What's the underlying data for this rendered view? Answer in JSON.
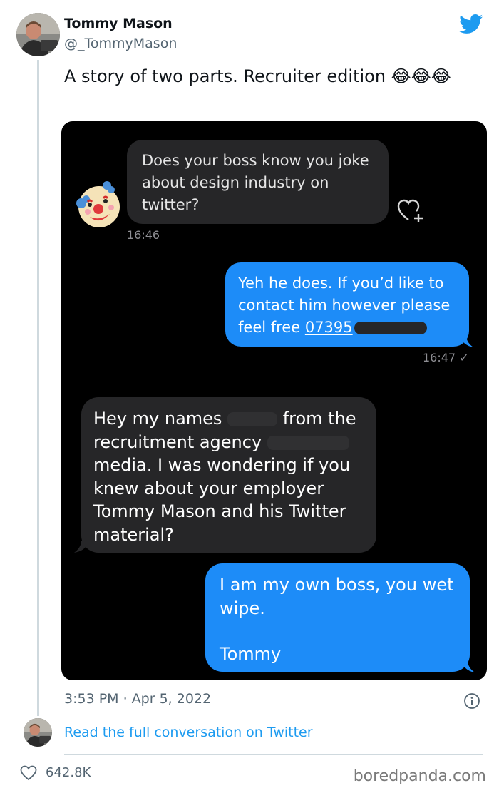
{
  "tweet": {
    "author_name": "Tommy Mason",
    "author_handle": "@_TommyMason",
    "text": "A story of two parts. Recruiter edition 😂😂😂",
    "timestamp": "3:53 PM · Apr 5, 2022",
    "read_full": "Read the full conversation on Twitter",
    "likes": "642.8K",
    "brand_color": "#1d9bf0"
  },
  "chat": {
    "messages": [
      {
        "side": "left",
        "text_lines": [
          "Does your boss know you joke",
          "about design industry on",
          "twitter?"
        ],
        "time": "16:46"
      },
      {
        "side": "right",
        "text_lines": [
          "Yeh he does. If you’d like to",
          "contact him however please"
        ],
        "tail_prefix": "feel free ",
        "phone_visible": "07395",
        "time": "16:47 ✓"
      },
      {
        "side": "left",
        "line1_a": "Hey my names ",
        "line1_b": " from the",
        "line2_a": "recruitment agency ",
        "text_lines": [
          "media. I was wondering if you",
          "knew about your employer",
          "Tommy Mason and his Twitter",
          "material?"
        ]
      },
      {
        "side": "right",
        "text_lines": [
          "I am my own boss, you wet",
          "wipe."
        ],
        "signoff": "Tommy"
      }
    ],
    "icons": [
      "clown-face-emoji",
      "heart-plus-icon"
    ]
  },
  "footer": {
    "watermark": "boredpanda.com"
  }
}
